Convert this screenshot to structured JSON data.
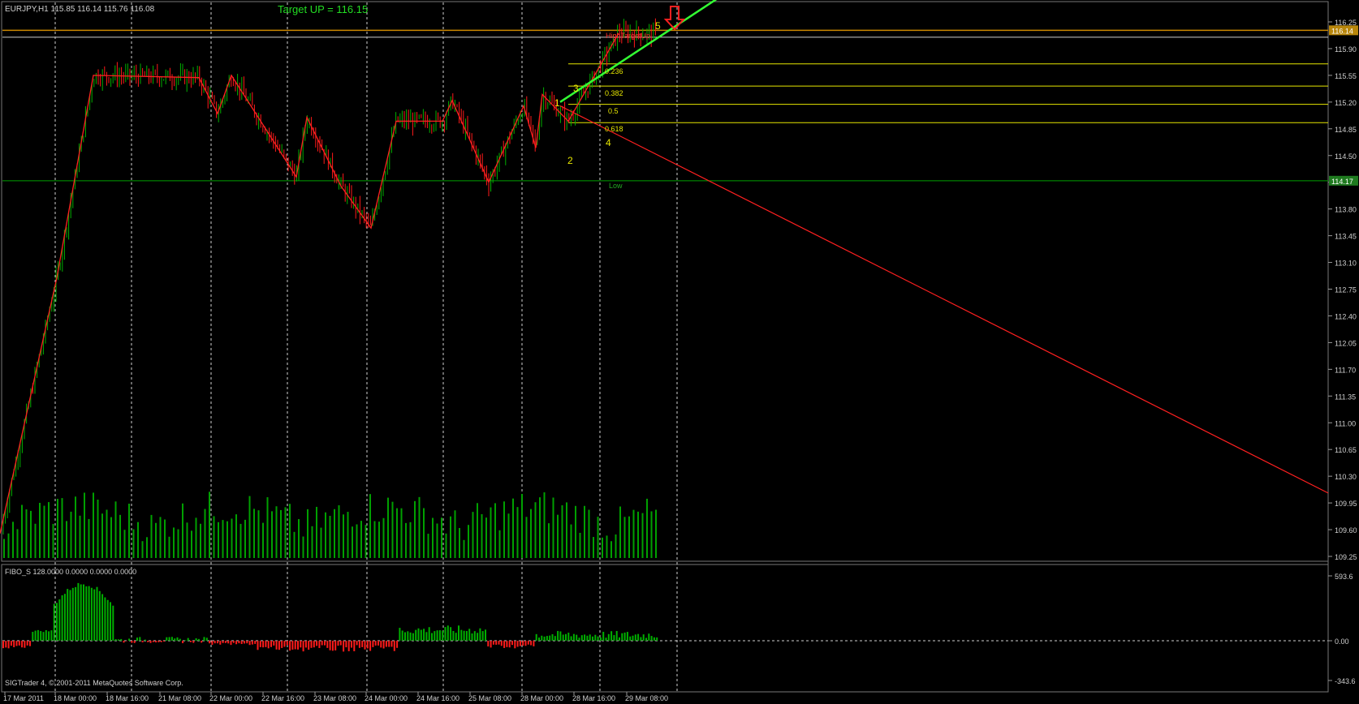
{
  "header": {
    "symbol_line": "EURJPY,H1  115.85 116.14 115.76 116.08",
    "target_label": "Target UP = 116.15"
  },
  "indicator": {
    "title": "FIBO_S 128.0000 0.0000 0.0000 0.0000",
    "axis_labels": [
      "593.6",
      "0.00",
      "-343.6"
    ],
    "ylim": [
      -343.6,
      593.6
    ]
  },
  "footer": {
    "copyright": "SIGTrader 4, © 2001-2011 MetaQuotes Software Corp."
  },
  "price_axis": {
    "ticks": [
      "116.25",
      "115.90",
      "115.55",
      "115.20",
      "114.85",
      "114.50",
      "114.15",
      "113.80",
      "113.45",
      "113.10",
      "112.75",
      "112.40",
      "112.05",
      "111.70",
      "111.35",
      "111.00",
      "110.65",
      "110.30",
      "109.95",
      "109.60",
      "109.25"
    ],
    "ylim": [
      109.25,
      116.25
    ],
    "badges": [
      {
        "text": "116.14",
        "value": 116.14,
        "color": "#b8860b"
      },
      {
        "text": "114.17",
        "value": 114.17,
        "color": "#1f7a1f"
      }
    ]
  },
  "time_axis": {
    "labels": [
      "17 Mar 2011",
      "18 Mar 00:00",
      "18 Mar 16:00",
      "21 Mar 08:00",
      "22 Mar 00:00",
      "22 Mar 16:00",
      "23 Mar 08:00",
      "24 Mar 00:00",
      "24 Mar 16:00",
      "25 Mar 08:00",
      "28 Mar 00:00",
      "28 Mar 16:00",
      "29 Mar 08:00"
    ]
  },
  "levels": {
    "high_target_label": "HighTargetUp",
    "low_label": "Low",
    "fib_labels": [
      "0.236",
      "0.382",
      "0.5",
      "0.618"
    ],
    "fib_values": [
      115.7,
      115.41,
      115.17,
      114.93
    ],
    "high_value": 116.14,
    "high2_value": 116.05,
    "low_value": 114.17
  },
  "wave_labels": [
    "1",
    "2",
    "3",
    "4",
    "5"
  ],
  "colors": {
    "bull": "#00b000",
    "bear": "#ff1a1a",
    "zigzag": "#ff2020",
    "fib": "#e6e600",
    "trend": "#33ff33",
    "grid_line": "#00a000",
    "orange_line": "#cc8800"
  },
  "chart_data": {
    "type": "line",
    "title": "EURJPY,H1",
    "zigzag_points": [
      [
        0,
        109.55
      ],
      [
        70,
        112.9
      ],
      [
        115,
        115.55
      ],
      [
        245,
        115.52
      ],
      [
        268,
        115.05
      ],
      [
        285,
        115.55
      ],
      [
        365,
        114.22
      ],
      [
        378,
        115.0
      ],
      [
        420,
        114.1
      ],
      [
        457,
        113.55
      ],
      [
        488,
        114.95
      ],
      [
        545,
        114.95
      ],
      [
        557,
        115.22
      ],
      [
        602,
        114.15
      ],
      [
        645,
        115.15
      ],
      [
        660,
        114.6
      ],
      [
        668,
        115.3
      ],
      [
        700,
        114.95
      ],
      [
        762,
        116.1
      ]
    ],
    "volume_note": "tick volume histogram",
    "fibo_s_series": "histogram, positive green, negative red"
  }
}
